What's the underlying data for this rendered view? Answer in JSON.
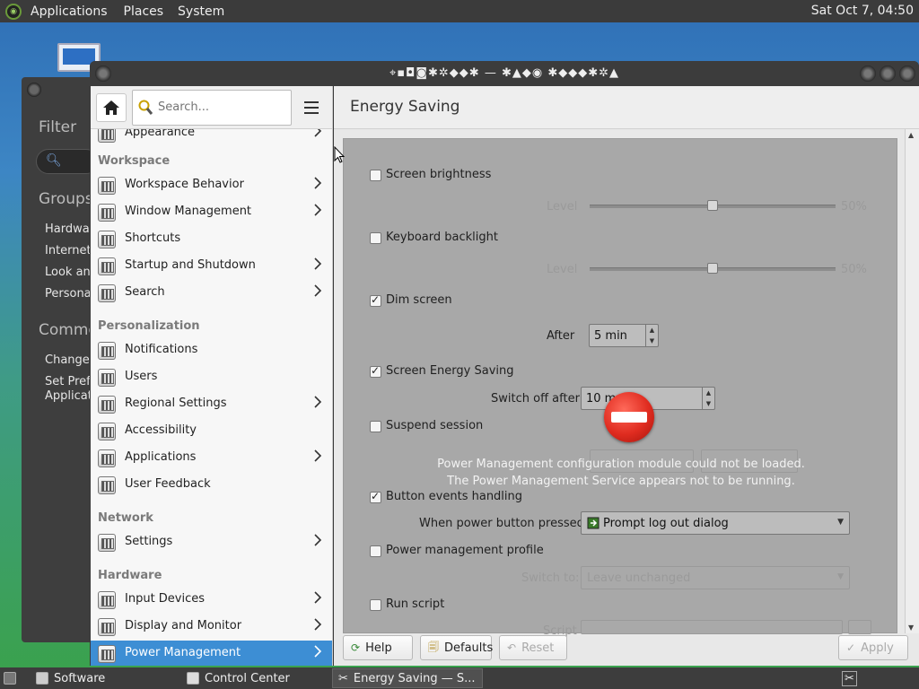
{
  "top_panel": {
    "menus": [
      "Applications",
      "Places",
      "System"
    ],
    "clock": "Sat Oct  7, 04:50"
  },
  "bg_window": {
    "filter_label": "Filter",
    "groups_label": "Groups",
    "group_items": [
      "Hardwar",
      "Internet",
      "Look and",
      "Personal"
    ],
    "common_label": "Commo",
    "common_items": [
      "Change",
      "Set Prefe",
      "Applicati"
    ]
  },
  "window": {
    "title": "⌖▪◘◙✱✲◆◆✱ — ✱▲◆◉ ✱◆◆◆✱✲▲",
    "help_label": "Help",
    "defaults_label": "Defaults",
    "reset_label": "Reset",
    "apply_label": "Apply"
  },
  "sidebar": {
    "search_placeholder": "Search...",
    "partial_item": "Appearance",
    "sections": [
      {
        "title": "Workspace",
        "items": [
          {
            "label": "Workspace Behavior",
            "icon": "workspace-icon",
            "chevron": true
          },
          {
            "label": "Window Management",
            "icon": "window-icon",
            "chevron": true
          },
          {
            "label": "Shortcuts",
            "icon": "keyboard-icon",
            "chevron": false
          },
          {
            "label": "Startup and Shutdown",
            "icon": "tools-icon",
            "chevron": true
          },
          {
            "label": "Search",
            "icon": "search-config-icon",
            "chevron": true
          }
        ]
      },
      {
        "title": "Personalization",
        "items": [
          {
            "label": "Notifications",
            "icon": "notification-icon",
            "chevron": false
          },
          {
            "label": "Users",
            "icon": "users-icon",
            "chevron": false
          },
          {
            "label": "Regional Settings",
            "icon": "regional-icon",
            "chevron": true
          },
          {
            "label": "Accessibility",
            "icon": "accessibility-icon",
            "chevron": false
          },
          {
            "label": "Applications",
            "icon": "applications-icon",
            "chevron": true
          },
          {
            "label": "User Feedback",
            "icon": "feedback-icon",
            "chevron": false
          }
        ]
      },
      {
        "title": "Network",
        "items": [
          {
            "label": "Settings",
            "icon": "network-icon",
            "chevron": true
          }
        ]
      },
      {
        "title": "Hardware",
        "items": [
          {
            "label": "Input Devices",
            "icon": "input-icon",
            "chevron": true
          },
          {
            "label": "Display and Monitor",
            "icon": "display-icon",
            "chevron": true
          },
          {
            "label": "Power Management",
            "icon": "power-icon",
            "chevron": true,
            "selected": true
          }
        ]
      }
    ]
  },
  "energy": {
    "title": "Energy Saving",
    "screen_brightness": {
      "label": "Screen brightness",
      "checked": false,
      "level_label": "Level",
      "level": "50%",
      "level_value": 0.5
    },
    "keyboard_backlight": {
      "label": "Keyboard backlight",
      "checked": false,
      "level_label": "Level",
      "level": "50%",
      "level_value": 0.5
    },
    "dim_screen": {
      "label": "Dim screen",
      "checked": true,
      "after_label": "After",
      "after_value": "5 min"
    },
    "screen_energy": {
      "label": "Screen Energy Saving",
      "checked": true,
      "switch_label": "Switch off after",
      "switch_value": "10 m"
    },
    "suspend": {
      "label": "Suspend session",
      "checked": false
    },
    "error_lines": [
      "Power Management configuration module could not be loaded.",
      "The Power Management Service appears not to be running."
    ],
    "button_events": {
      "label": "Button events handling",
      "checked": true,
      "power_label": "When power button pressed",
      "power_value": "Prompt log out dialog"
    },
    "profile": {
      "label": "Power management profile",
      "checked": false,
      "switch_label": "Switch to:",
      "switch_value": "Leave unchanged"
    },
    "run_script": {
      "label": "Run script",
      "checked": false,
      "script_label": "Script"
    }
  },
  "taskbar": {
    "tasks": [
      {
        "label": "Software"
      },
      {
        "label": "Control Center"
      },
      {
        "label": "Energy Saving  — S..."
      }
    ]
  }
}
